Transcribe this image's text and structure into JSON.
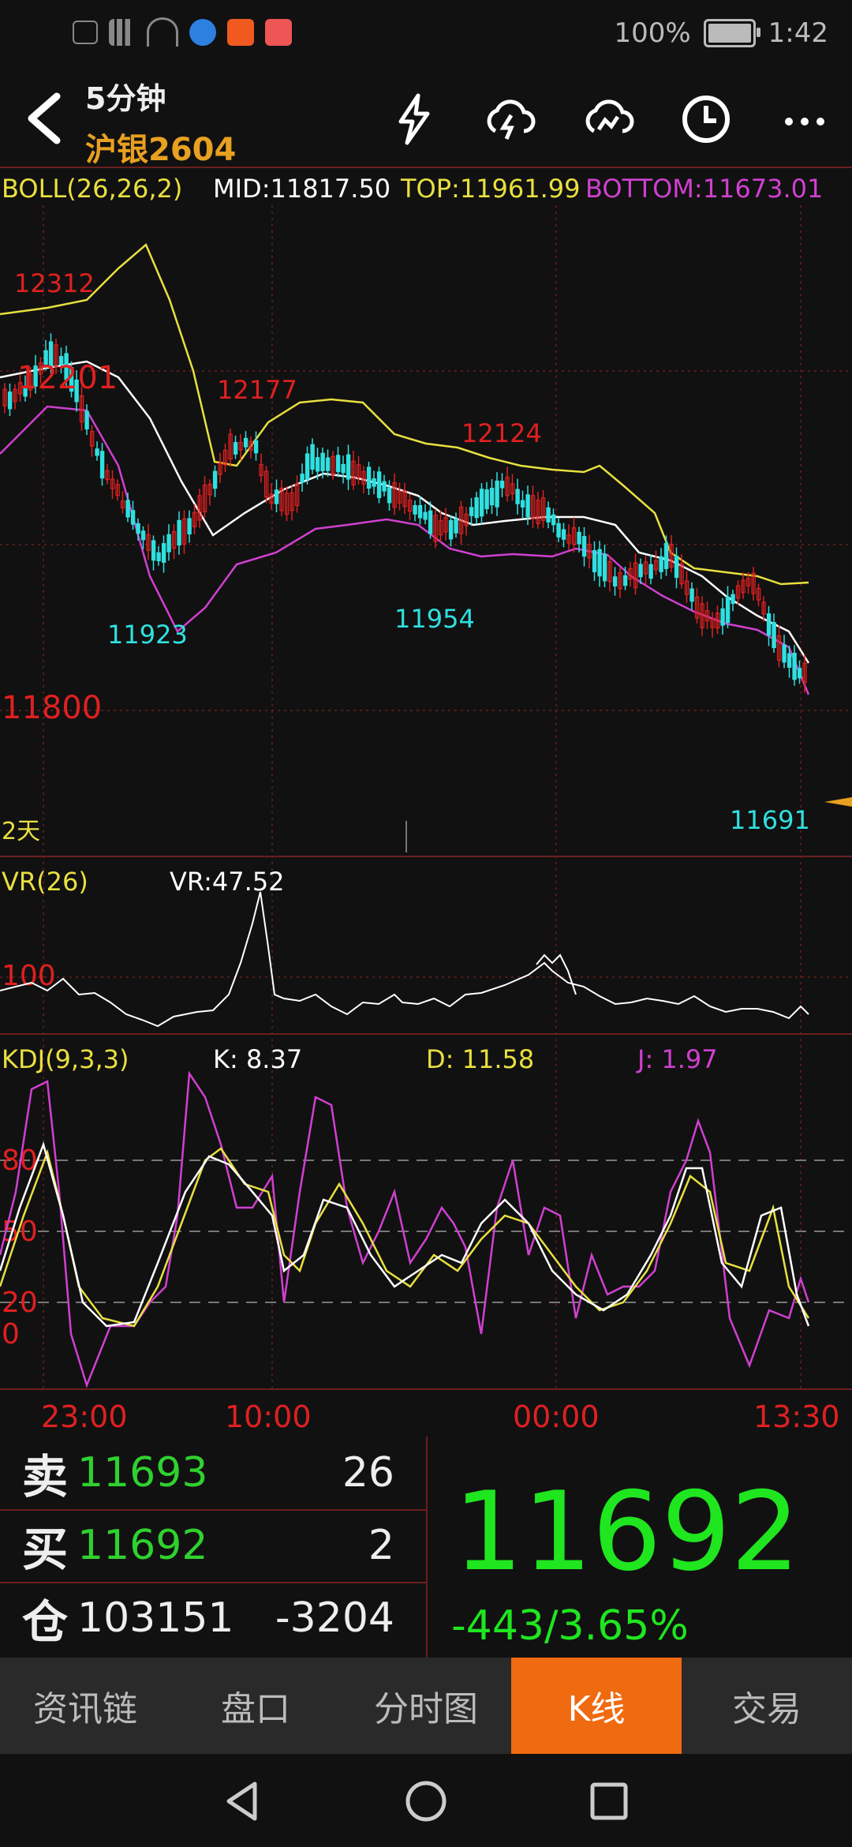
{
  "status_bar": {
    "left_icons": [
      "hd-icon",
      "4g-signal-icon",
      "wifi-icon",
      "app-icon",
      "app-icon",
      "app-icon"
    ],
    "battery": "100%",
    "time": "1:42"
  },
  "header": {
    "period": "5分钟",
    "contract": "沪银2604"
  },
  "indicators": {
    "boll": {
      "label": "BOLL(26,26,2)",
      "mid": "MID:11817.50",
      "top": "TOP:11961.99",
      "bottom": "BOTTOM:11673.01"
    },
    "vr": {
      "label": "VR(26)",
      "value": "VR:47.52",
      "level": "100"
    },
    "kdj": {
      "label": "KDJ(9,3,3)",
      "k": "K: 8.37",
      "d": "D: 11.58",
      "j": "J: 1.97",
      "levels": [
        "80",
        "50",
        "20",
        "0"
      ]
    }
  },
  "chart_labels": {
    "high1": "12312",
    "high1b": "12201",
    "high2": "12177",
    "high3": "12124",
    "low1": "11923",
    "low2": "11954",
    "low3": "11691",
    "level": "11800",
    "period": "2天"
  },
  "time_axis": [
    "23:00",
    "10:00",
    "00:00",
    "13:30"
  ],
  "quote": {
    "sell_label": "卖",
    "sell_price": "11693",
    "sell_vol": "26",
    "buy_label": "买",
    "buy_price": "11692",
    "buy_vol": "2",
    "oi_label": "仓",
    "oi": "103151",
    "oi_change": "-3204",
    "last": "11692",
    "change": "-443/3.65%"
  },
  "tabs": [
    "资讯链",
    "盘口",
    "分时图",
    "K线",
    "交易"
  ],
  "active_tab": "K线",
  "colors": {
    "up": "#e02020",
    "down": "#30e0e0",
    "mid": "#ffffff",
    "top": "#e8e040",
    "bottom": "#d040d0",
    "accent": "#f06a10"
  }
}
